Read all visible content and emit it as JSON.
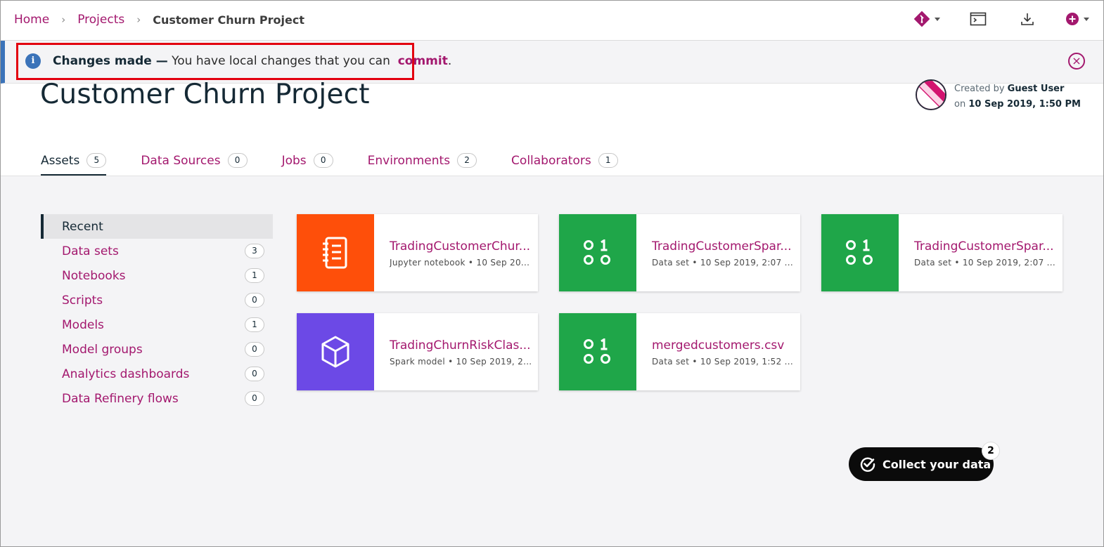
{
  "breadcrumb": {
    "items": [
      "Home",
      "Projects"
    ],
    "current": "Customer Churn Project"
  },
  "toolbar": {
    "icons": [
      "git-branch-icon",
      "terminal-icon",
      "download-icon",
      "add-icon"
    ]
  },
  "notification": {
    "bold": "Changes made —",
    "message": "You have local changes that you can",
    "link": "commit",
    "suffix": ".",
    "info_icon": "i",
    "close_icon": "×"
  },
  "project": {
    "title": "Customer Churn Project",
    "created_by_label": "Created by",
    "created_by": "Guest User",
    "created_on_label": "on",
    "created_on": "10 Sep 2019, 1:50 PM"
  },
  "tabs": [
    {
      "label": "Assets",
      "count": "5"
    },
    {
      "label": "Data Sources",
      "count": "0"
    },
    {
      "label": "Jobs",
      "count": "0"
    },
    {
      "label": "Environments",
      "count": "2"
    },
    {
      "label": "Collaborators",
      "count": "1"
    }
  ],
  "sidebar": {
    "items": [
      {
        "label": "Recent",
        "count": ""
      },
      {
        "label": "Data sets",
        "count": "3"
      },
      {
        "label": "Notebooks",
        "count": "1"
      },
      {
        "label": "Scripts",
        "count": "0"
      },
      {
        "label": "Models",
        "count": "1"
      },
      {
        "label": "Model groups",
        "count": "0"
      },
      {
        "label": "Analytics dashboards",
        "count": "0"
      },
      {
        "label": "Data Refinery flows",
        "count": "0"
      }
    ]
  },
  "assets": [
    {
      "title": "TradingCustomerChur...",
      "meta": "Jupyter notebook • 10 Sep 20...",
      "icon": "notebook-icon",
      "color": "#fe4f0a"
    },
    {
      "title": "TradingCustomerSpar...",
      "meta": "Data set • 10 Sep 2019, 2:07 ...",
      "icon": "data-set-icon",
      "color": "#1fa649"
    },
    {
      "title": "TradingCustomerSpar...",
      "meta": "Data set • 10 Sep 2019, 2:07 ...",
      "icon": "data-set-icon",
      "color": "#1fa649"
    },
    {
      "title": "TradingChurnRiskClas...",
      "meta": "Spark model • 10 Sep 2019, 2...",
      "icon": "model-cube-icon",
      "color": "#6c49e6"
    },
    {
      "title": "mergedcustomers.csv",
      "meta": "Data set • 10 Sep 2019, 1:52 ...",
      "icon": "data-set-icon",
      "color": "#1fa649"
    }
  ],
  "collect": {
    "label": "Collect your data",
    "badge": "2"
  },
  "colors": {
    "accent": "#a3186e",
    "info": "#3b73b9",
    "highlight": "#e3000f"
  }
}
